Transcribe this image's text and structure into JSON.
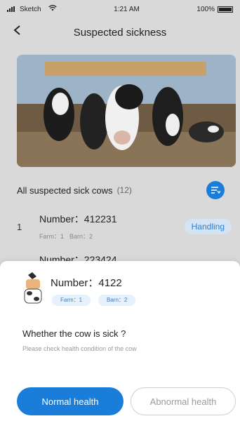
{
  "status_bar": {
    "carrier": "Sketch",
    "time": "1:21 AM",
    "battery": "100%"
  },
  "nav": {
    "title": "Suspected sickness",
    "back_icon": "chevron-left-icon"
  },
  "list": {
    "title": "All suspected sick cows",
    "count": "(12)",
    "filter_icon": "filter-list-icon",
    "items": [
      {
        "index": "1",
        "number": "Number：412231",
        "farm": "Farm：1",
        "barn": "Barn：2",
        "status": "Handling"
      }
    ],
    "partial_item": "Number：223424"
  },
  "sheet": {
    "number": "Number：4122",
    "farm": "Farm：1",
    "barn": "Barn：2",
    "question": "Whether the cow is sick ?",
    "hint": "Please check health condition of the cow",
    "normal_button": "Normal health",
    "abnormal_button": "Abnormal health"
  },
  "colors": {
    "accent": "#1a7dda",
    "pill_bg": "#d4e4f4",
    "tag_bg": "#e6f1fb"
  }
}
